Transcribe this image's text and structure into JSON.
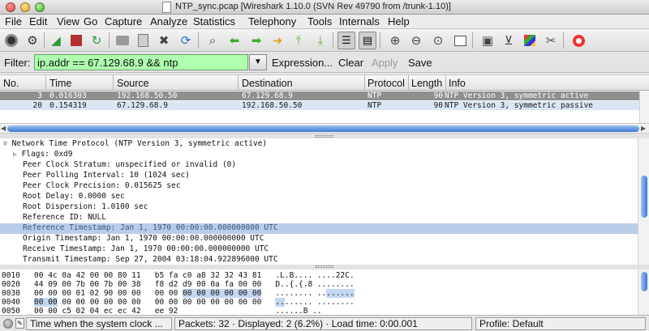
{
  "window": {
    "title": "NTP_sync.pcap  [Wireshark 1.10.0  (SVN Rev 49790 from /trunk-1.10)]"
  },
  "menu": [
    "File",
    "Edit",
    "View",
    "Go",
    "Capture",
    "Analyze",
    "Statistics",
    "Telephony",
    "Tools",
    "Internals",
    "Help"
  ],
  "toolbar": {
    "icons": [
      "interfaces-icon",
      "options-icon",
      "start-capture-icon",
      "stop-capture-icon",
      "restart-capture-icon",
      "open-file-icon",
      "save-file-icon",
      "close-file-icon",
      "reload-icon",
      "find-icon",
      "back-icon",
      "forward-icon",
      "go-to-packet-icon",
      "first-packet-icon",
      "last-packet-icon",
      "colorize-icon",
      "auto-scroll-icon",
      "zoom-in-icon",
      "zoom-out-icon",
      "normal-size-icon",
      "resize-columns-icon",
      "capture-filters-icon",
      "display-filters-icon",
      "coloring-rules-icon",
      "preferences-icon",
      "help-icon"
    ]
  },
  "filter": {
    "label": "Filter:",
    "value": "ip.addr == 67.129.68.9 && ntp",
    "expression": "Expression...",
    "clear": "Clear",
    "apply": "Apply",
    "save": "Save",
    "bg_color": "#afffaf"
  },
  "packet_list": {
    "columns": [
      "No.",
      "Time",
      "Source",
      "Destination",
      "Protocol",
      "Length",
      "Info"
    ],
    "rows": [
      {
        "no": "3",
        "time": "0.016303",
        "source": "192.168.50.50",
        "destination": "67.129.68.9",
        "protocol": "NTP",
        "length": "90",
        "info": "NTP Version 3, symmetric active"
      },
      {
        "no": "20",
        "time": "0.154319",
        "source": "67.129.68.9",
        "destination": "192.168.50.50",
        "protocol": "NTP",
        "length": "90",
        "info": "NTP Version 3, symmetric passive"
      }
    ]
  },
  "details": {
    "root": "Network Time Protocol (NTP Version 3, symmetric active)",
    "flags": "Flags: 0xd9",
    "lines": [
      "Peer Clock Stratum: unspecified or invalid (0)",
      "Peer Polling Interval: 10 (1024 sec)",
      "Peer Clock Precision: 0.015625 sec",
      "Root Delay:     0.0000 sec",
      "Root Dispersion:     1.0100 sec",
      "Reference ID: NULL",
      "Reference Timestamp: Jan  1, 1970 00:00:00.000000000 UTC",
      "Origin Timestamp: Jan  1, 1970 00:00:00.000000000 UTC",
      "Receive Timestamp: Jan  1, 1970 00:00:00.000000000 UTC",
      "Transmit Timestamp: Sep 27, 2004 03:18:04.922896000 UTC"
    ]
  },
  "hex": [
    {
      "pre": "0010   00 4c 0a 42 00 00 80 11   b5 fa c0 a8 32 32 43 81   .L.B.... ....22C.",
      "hl": "",
      "post": ""
    },
    {
      "pre": "0020   44 09 00 7b 00 7b 00 38   f8 d2 d9 00 0a fa 00 00   D..{.{.8 ........",
      "hl": "",
      "post": ""
    },
    {
      "pre": "0030   00 00 00 01 02 90 00 00   00 00 ",
      "hl": "00 00 00 00 00 00",
      "post": "   ........ ..",
      "hl2": "......",
      "post2": ""
    },
    {
      "pre": "0040   ",
      "hl": "00 00",
      "post": " 00 00 00 00 00 00   00 00 00 00 00 00 00 00   ",
      "hl2": "..",
      "post2": "...... ........"
    },
    {
      "pre": "0050   00 00 c5 02 04 ec ec 42   ee 92                     ......B ..",
      "hl": "",
      "post": ""
    }
  ],
  "status": {
    "hint": "Time when the system clock ...",
    "packets": "Packets: 32 · Displayed: 2 (6.2%) · Load time: 0:00.001",
    "profile": "Profile: Default"
  }
}
